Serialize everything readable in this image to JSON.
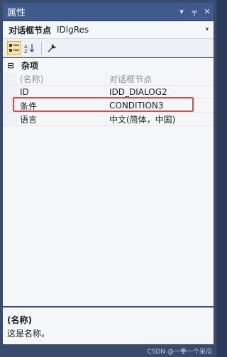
{
  "window": {
    "title": "属性",
    "buttons": {
      "dropdown": "▾",
      "pin": "╤",
      "close": "✕"
    }
  },
  "selector": {
    "object_name": "对话框节点",
    "object_type": "IDlgRes",
    "dropdown_arrow": "▾"
  },
  "toolbar": {
    "categorized_icon": "categorized-icon",
    "alphabetical_icon": "alphabetical-icon",
    "property_pages_icon": "wrench-icon"
  },
  "grid": {
    "category": {
      "toggle": "⊟",
      "label": "杂项"
    },
    "rows": [
      {
        "name": "(名称)",
        "value": "对话框节点",
        "muted": true
      },
      {
        "name": "ID",
        "value": "IDD_DIALOG2",
        "muted": false
      },
      {
        "name": "条件",
        "value": "CONDITION3",
        "muted": false,
        "highlighted": true
      },
      {
        "name": "语言",
        "value": "中文(简体，中国)",
        "muted": false
      }
    ]
  },
  "description": {
    "title": "(名称)",
    "text": "这是名称。"
  },
  "watermark": "CSDN @一拳一个呆瓜",
  "colors": {
    "titlebar": "#3f5a8c",
    "highlight_border": "#e04a4a",
    "active_tool": "#fce4a8"
  }
}
